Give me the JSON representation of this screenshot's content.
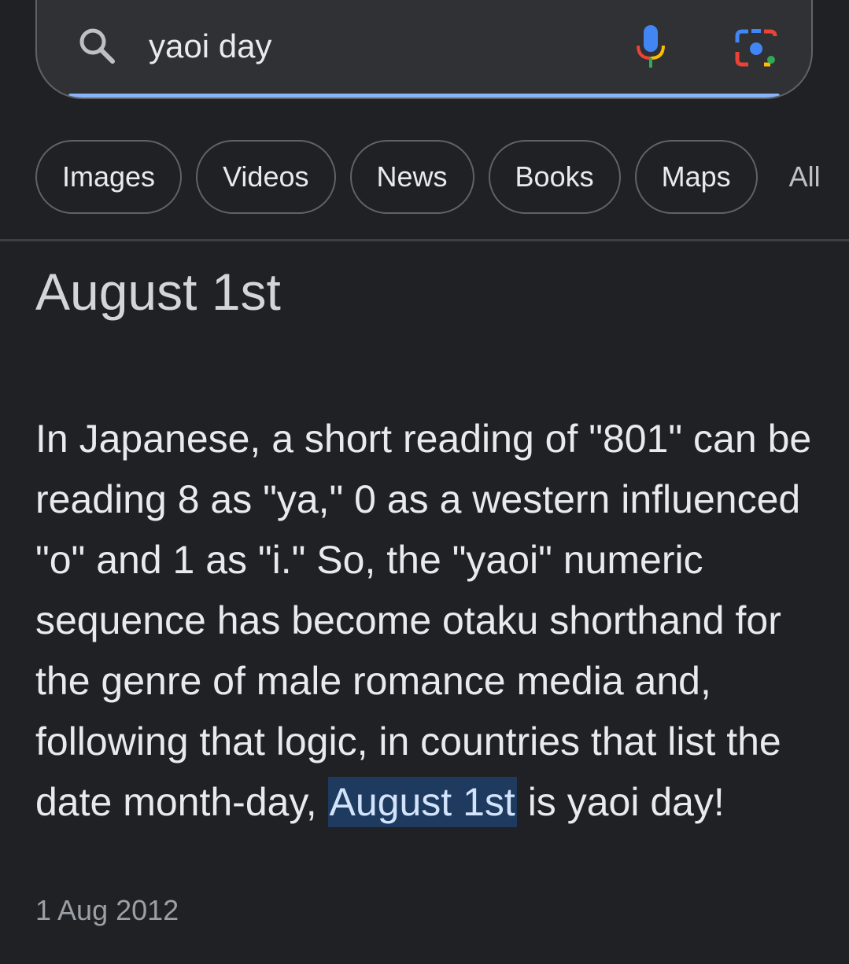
{
  "search": {
    "query": "yaoi day"
  },
  "chips": {
    "images": "Images",
    "videos": "Videos",
    "news": "News",
    "books": "Books",
    "maps": "Maps",
    "all": "All"
  },
  "featured_snippet": {
    "answer": "August 1st",
    "text_before": "In Japanese, a short reading of \"801\" can be reading 8 as \"ya,\" 0 as a western influenced \"o\" and 1 as \"i.\" So, the \"yaoi\" numeric sequence has become otaku shorthand for the genre of male romance media and, following that logic, in countries that list the date month-day,",
    "highlight": "August 1st",
    "text_after": "is yaoi day!",
    "date": "1 Aug 2012"
  },
  "colors": {
    "background": "#202124",
    "search_underline": "#8ab4f8",
    "highlight_bg": "#1f3a5f"
  },
  "icons": {
    "search": "search-icon",
    "voice": "microphone-icon",
    "lens": "google-lens-icon"
  }
}
